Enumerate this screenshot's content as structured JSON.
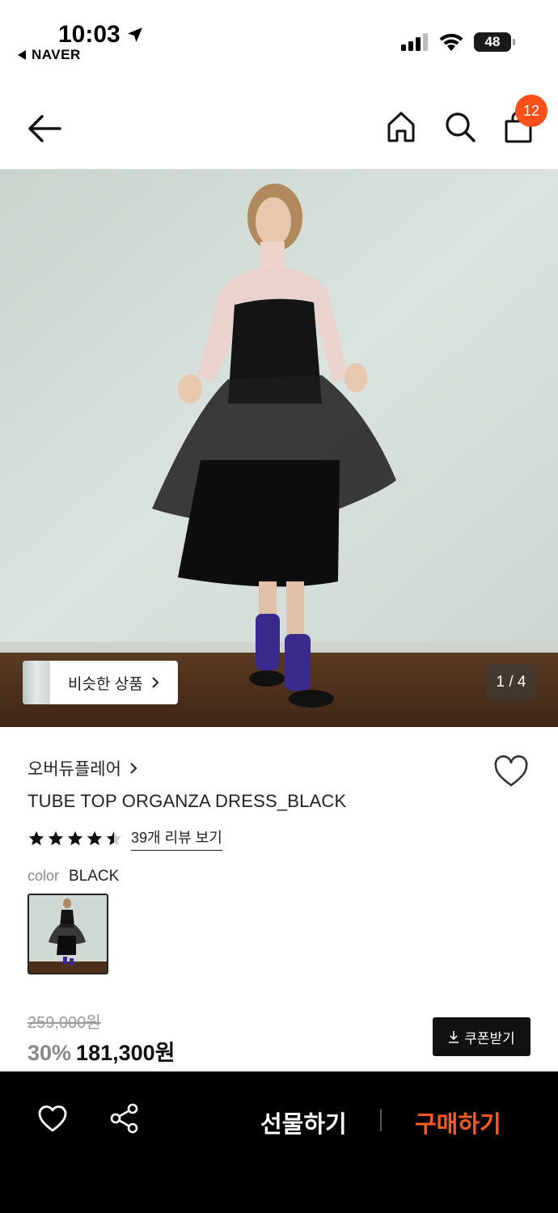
{
  "status_bar": {
    "time": "10:03",
    "back_app": "NAVER",
    "battery": "48"
  },
  "nav": {
    "cart_count": "12"
  },
  "hero": {
    "similar_label": "비슷한 상품",
    "page_counter": "1 / 4"
  },
  "product": {
    "brand": "오버듀플레어",
    "title": "TUBE TOP ORGANZA DRESS_BLACK",
    "rating": 4.5,
    "review_link": "39개 리뷰 보기",
    "color_key": "color",
    "color_value": "BLACK",
    "original_price": "259,000원",
    "discount": "30%",
    "price": "181,300원",
    "coupon_label": "쿠폰받기"
  },
  "bottom_bar": {
    "gift_label": "선물하기",
    "buy_label": "구매하기"
  },
  "colors": {
    "accent_orange": "#ff5a1f",
    "badge_orange": "#ff4f1a",
    "bottom_bar_bg": "#000000"
  },
  "icons": [
    "location-arrow-icon",
    "signal-icon",
    "wifi-icon",
    "battery-icon",
    "back-arrow-icon",
    "home-icon",
    "search-icon",
    "shopping-bag-icon",
    "chevron-right-icon",
    "heart-icon",
    "star-icon",
    "download-icon",
    "share-icon"
  ]
}
